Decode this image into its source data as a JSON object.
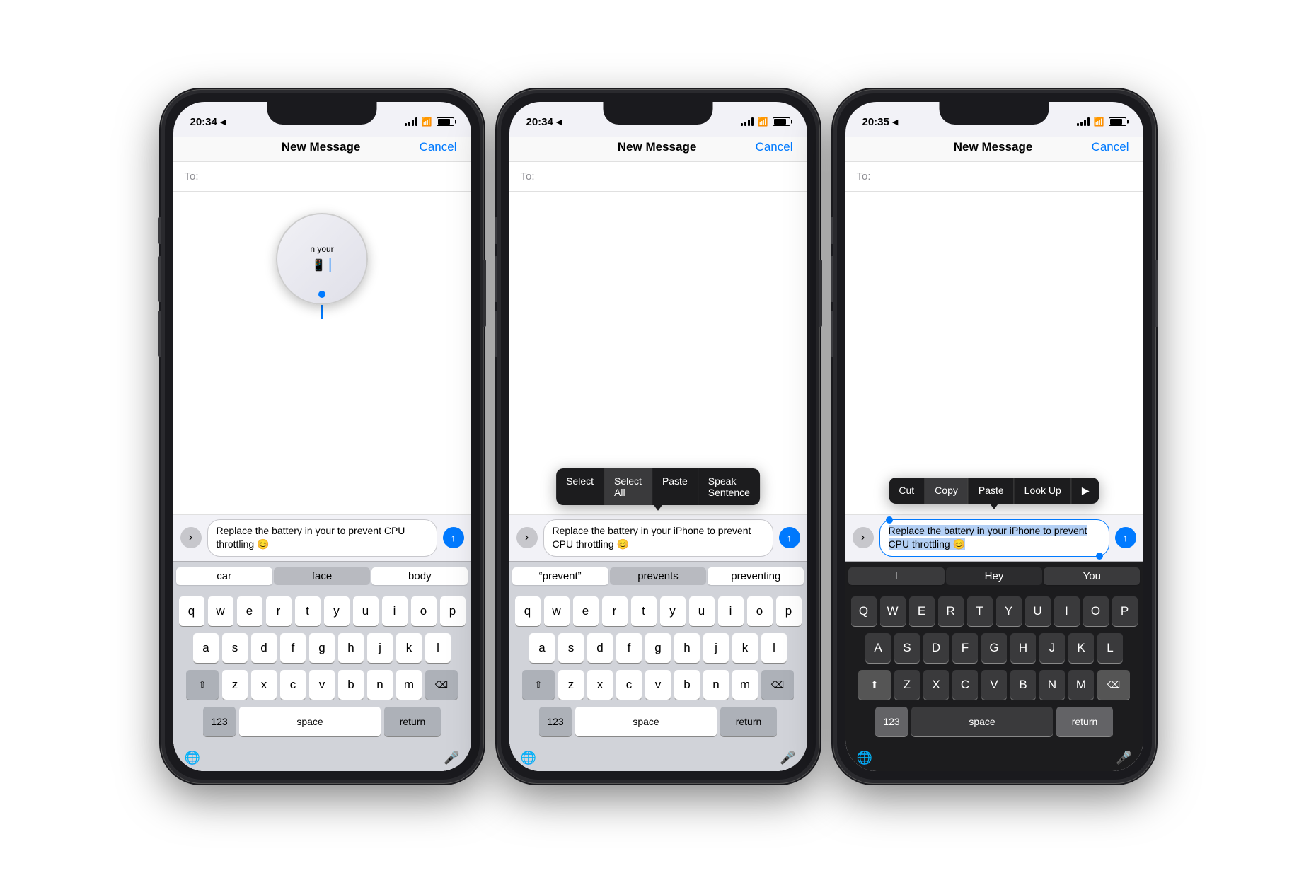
{
  "phones": [
    {
      "id": "phone1",
      "time": "20:34",
      "title": "New Message",
      "cancel": "Cancel",
      "to_placeholder": "To:",
      "message_text": "Replace the battery in your to prevent CPU throttling 😊",
      "suggestions": [
        "car",
        "face",
        "body"
      ],
      "keyboard_type": "lowercase",
      "show_magnifier": true,
      "context_type": "none"
    },
    {
      "id": "phone2",
      "time": "20:34",
      "title": "New Message",
      "cancel": "Cancel",
      "to_placeholder": "To:",
      "message_text": "Replace the battery in your iPhone to prevent CPU throttling 😊",
      "suggestions": [
        "“prevent”",
        "prevents",
        "preventing"
      ],
      "keyboard_type": "lowercase",
      "show_magnifier": false,
      "context_type": "select-menu",
      "menu_items": [
        "Select",
        "Select All",
        "Paste",
        "Speak Sentence"
      ]
    },
    {
      "id": "phone3",
      "time": "20:35",
      "title": "New Message",
      "cancel": "Cancel",
      "to_placeholder": "To:",
      "message_text": "Replace the battery in your iPhone to prevent CPU throttling 😊",
      "suggestions": [
        "I",
        "Hey",
        "You"
      ],
      "keyboard_type": "uppercase",
      "show_magnifier": false,
      "context_type": "copy-menu",
      "menu_items": [
        "Cut",
        "Copy",
        "Paste",
        "Look Up",
        "▶"
      ]
    }
  ]
}
